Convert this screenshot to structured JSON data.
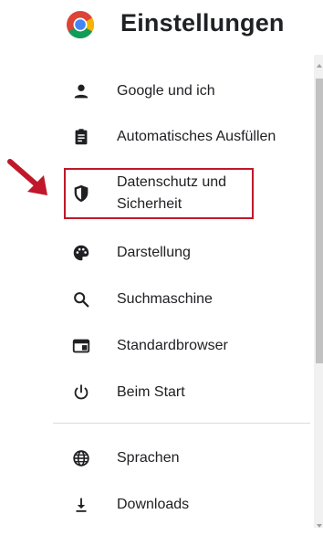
{
  "header": {
    "title": "Einstellungen",
    "logo_icon": "chrome-logo-icon"
  },
  "nav": {
    "items": [
      {
        "label": "Google und ich",
        "icon": "person-icon"
      },
      {
        "label": "Automatisches Ausfüllen",
        "icon": "clipboard-icon"
      },
      {
        "label": "Datenschutz und Sicherheit",
        "icon": "shield-icon",
        "highlighted": true
      },
      {
        "label": "Darstellung",
        "icon": "palette-icon"
      },
      {
        "label": "Suchmaschine",
        "icon": "search-icon"
      },
      {
        "label": "Standardbrowser",
        "icon": "browser-window-icon"
      },
      {
        "label": "Beim Start",
        "icon": "power-icon"
      },
      {
        "label": "Sprachen",
        "icon": "globe-icon"
      },
      {
        "label": "Downloads",
        "icon": "download-icon"
      }
    ]
  },
  "annotation": {
    "color": "#c0182a",
    "arrow_icon": "red-arrow-icon"
  }
}
